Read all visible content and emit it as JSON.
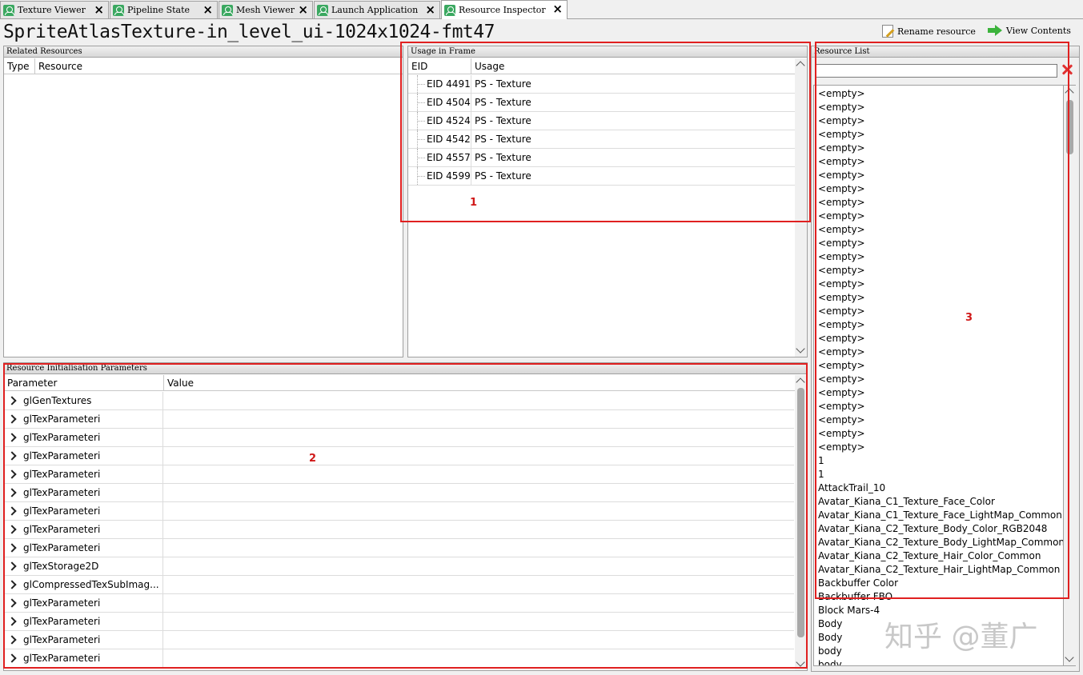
{
  "tabs": [
    {
      "label": "Texture Viewer"
    },
    {
      "label": "Pipeline State"
    },
    {
      "label": "Mesh Viewer"
    },
    {
      "label": "Launch Application"
    },
    {
      "label": "Resource Inspector"
    }
  ],
  "resource_title": "SpriteAtlasTexture-in_level_ui-1024x1024-fmt47",
  "toolbar": {
    "rename_label": "Rename resource",
    "view_label": "View Contents"
  },
  "related": {
    "title": "Related Resources",
    "col_type": "Type",
    "col_resource": "Resource"
  },
  "usage": {
    "title": "Usage in Frame",
    "col_eid": "EID",
    "col_usage": "Usage",
    "rows": [
      {
        "eid": "EID 4491",
        "usage": "PS - Texture"
      },
      {
        "eid": "EID 4504",
        "usage": "PS - Texture"
      },
      {
        "eid": "EID 4524",
        "usage": "PS - Texture"
      },
      {
        "eid": "EID 4542",
        "usage": "PS - Texture"
      },
      {
        "eid": "EID 4557",
        "usage": "PS - Texture"
      },
      {
        "eid": "EID 4599",
        "usage": "PS - Texture"
      }
    ]
  },
  "params": {
    "title": "Resource Initialisation Parameters",
    "col_param": "Parameter",
    "col_value": "Value",
    "rows": [
      {
        "name": "glGenTextures"
      },
      {
        "name": "glTexParameteri"
      },
      {
        "name": "glTexParameteri"
      },
      {
        "name": "glTexParameteri"
      },
      {
        "name": "glTexParameteri"
      },
      {
        "name": "glTexParameteri"
      },
      {
        "name": "glTexParameteri"
      },
      {
        "name": "glTexParameteri"
      },
      {
        "name": "glTexParameteri"
      },
      {
        "name": "glTexStorage2D"
      },
      {
        "name": "glCompressedTexSubImag..."
      },
      {
        "name": "glTexParameteri"
      },
      {
        "name": "glTexParameteri"
      },
      {
        "name": "glTexParameteri"
      },
      {
        "name": "glTexParameteri"
      }
    ]
  },
  "resource_list": {
    "title": "Resource List",
    "search_value": "",
    "items": [
      "<empty>",
      "<empty>",
      "<empty>",
      "<empty>",
      "<empty>",
      "<empty>",
      "<empty>",
      "<empty>",
      "<empty>",
      "<empty>",
      "<empty>",
      "<empty>",
      "<empty>",
      "<empty>",
      "<empty>",
      "<empty>",
      "<empty>",
      "<empty>",
      "<empty>",
      "<empty>",
      "<empty>",
      "<empty>",
      "<empty>",
      "<empty>",
      "<empty>",
      "<empty>",
      "<empty>",
      "1",
      "1",
      "AttackTrail_10",
      "Avatar_Kiana_C1_Texture_Face_Color",
      "Avatar_Kiana_C1_Texture_Face_LightMap_Common",
      "Avatar_Kiana_C2_Texture_Body_Color_RGB2048",
      "Avatar_Kiana_C2_Texture_Body_LightMap_Common",
      "Avatar_Kiana_C2_Texture_Hair_Color_Common",
      "Avatar_Kiana_C2_Texture_Hair_LightMap_Common",
      "Backbuffer Color",
      "Backbuffer FBO",
      "Block Mars-4",
      "Body",
      "Body",
      "body",
      "body"
    ]
  },
  "annotations": [
    "1",
    "2",
    "3"
  ],
  "watermark": "知乎 @董广",
  "colors": {
    "annotation": "#e02020",
    "tab_icon": "#3aa860",
    "view_icon": "#3cb33c"
  }
}
